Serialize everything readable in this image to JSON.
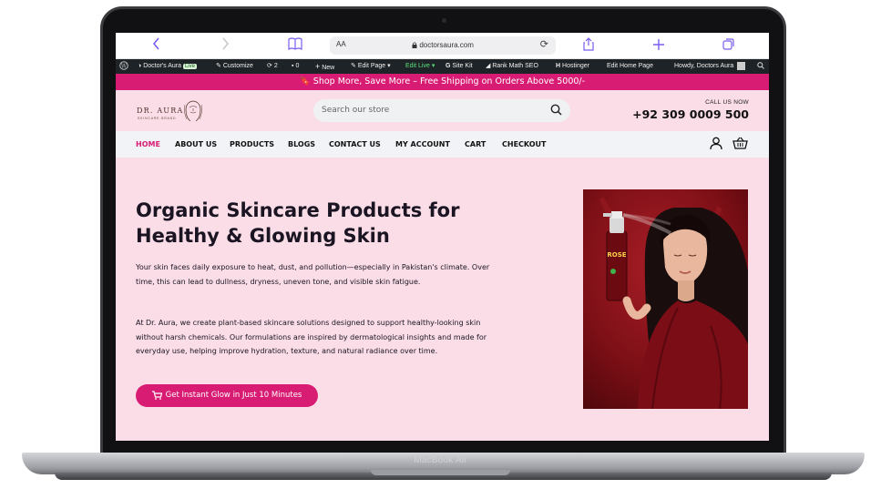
{
  "device": {
    "model_label": "MacBook Air"
  },
  "browser": {
    "url": "doctorsaura.com",
    "aa_label": "AA",
    "icons": [
      "back-icon",
      "forward-icon",
      "bookmarks-icon",
      "lock-icon",
      "reload-icon",
      "share-icon",
      "new-tab-icon",
      "tabs-icon"
    ]
  },
  "wp_admin_bar": {
    "site_name": "Doctor's Aura",
    "live_badge": "Live",
    "customize": "Customize",
    "updates_count": "2",
    "comments_count": "0",
    "new": "New",
    "edit_page": "Edit Page",
    "edit_live": "Edit Live",
    "site_kit": "Site Kit",
    "rank_math": "Rank Math SEO",
    "hostinger": "Hostinger",
    "edit_home_page": "Edit Home Page",
    "howdy": "Howdy, Doctors Aura"
  },
  "promo": {
    "text": "🔖 Shop More, Save More – Free Shipping on Orders Above 5000/-"
  },
  "header": {
    "logo_text": "DR. AURA",
    "logo_subtext": "SKINCARE BRAND",
    "search_placeholder": "Search our store",
    "call_label": "CALL US NOW",
    "phone": "+92 309 0009 500"
  },
  "nav": {
    "items": [
      {
        "label": "HOME",
        "active": true
      },
      {
        "label": "ABOUT US",
        "active": false
      },
      {
        "label": "PRODUCTS",
        "active": false
      },
      {
        "label": "BLOGS",
        "active": false
      },
      {
        "label": "CONTACT US",
        "active": false
      },
      {
        "label": "MY ACCOUNT",
        "active": false
      },
      {
        "label": "CART",
        "active": false
      },
      {
        "label": "CHECKOUT",
        "active": false
      }
    ]
  },
  "hero": {
    "title": "Organic Skincare Products for Healthy & Glowing Skin",
    "paragraph_1": "Your skin faces daily exposure to heat, dust, and pollution—especially in Pakistan's climate. Over time, this can lead to dullness, dryness, uneven tone, and visible skin fatigue.",
    "paragraph_2": "At Dr. Aura, we create plant-based skincare solutions designed to support healthy-looking skin without harsh chemicals. Our formulations are inspired by dermatological insights and made for everyday use, helping improve hydration, texture, and natural radiance over time.",
    "cta_label": "Get Instant Glow in Just 10 Minutes",
    "bottle_label": "ROSE"
  },
  "colors": {
    "accent": "#d81b73",
    "page_bg": "#fadde6",
    "nav_bg": "#f2f3f7",
    "admin_bar": "#1d2327",
    "safari_accent": "#7a5cf0"
  }
}
